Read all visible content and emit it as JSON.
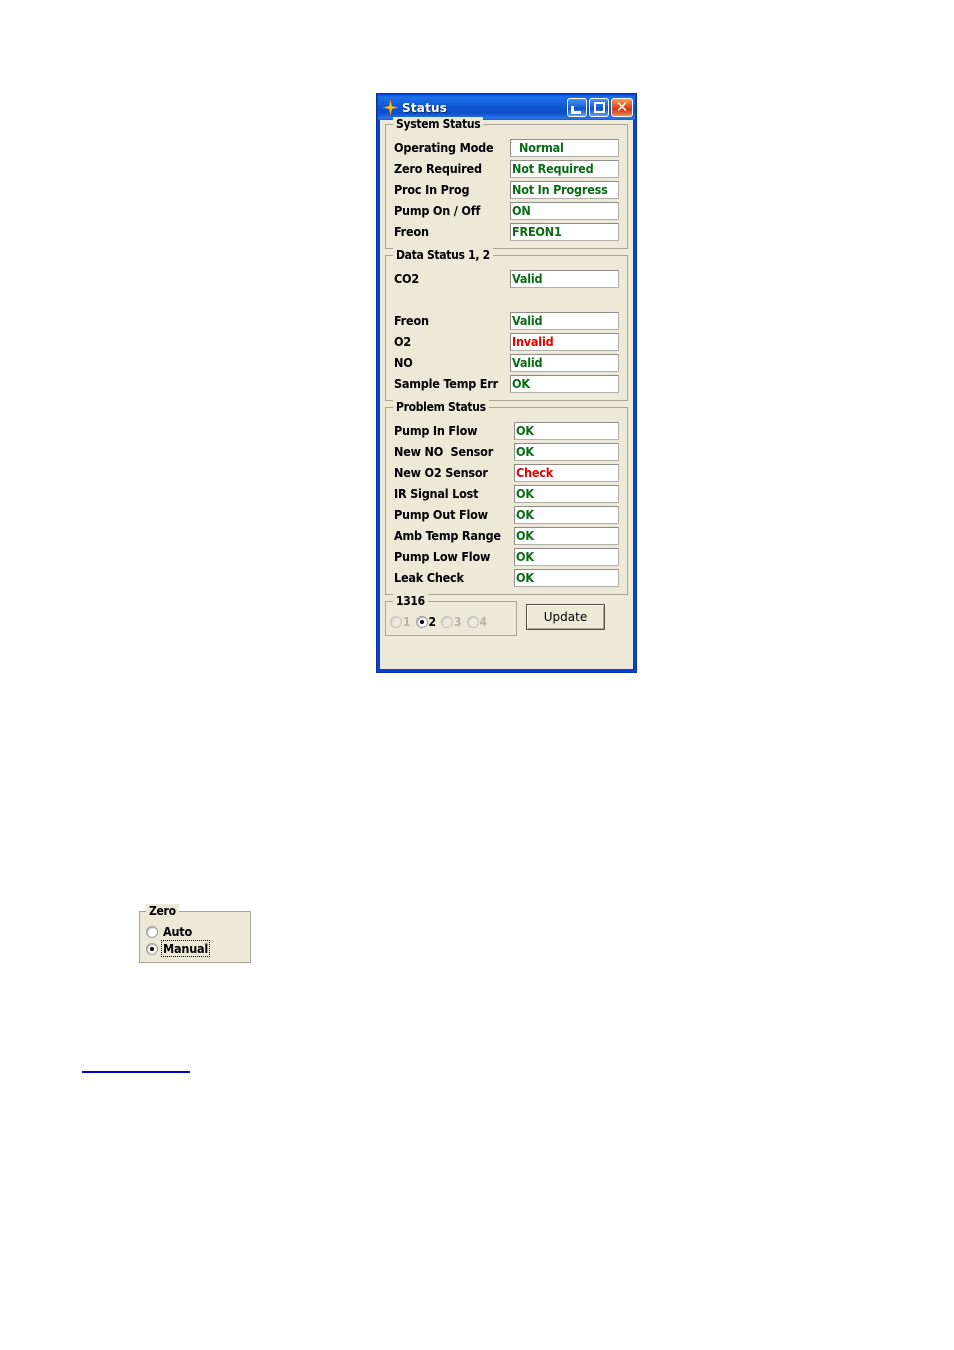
{
  "window": {
    "title": "Status",
    "icon": "sparkle-icon",
    "controls": {
      "minimize": "minimize-icon",
      "maximize": "maximize-icon",
      "close": "✕"
    }
  },
  "colors": {
    "titlebar": "#0f54cf",
    "dialog_bg": "#ece9d8",
    "ok_text": "#0a6b17",
    "alert_text": "#e60000",
    "link": "#0000cc"
  },
  "groups": {
    "system_status": {
      "title": "System Status",
      "rows": [
        {
          "label": "Operating Mode",
          "value": "Normal",
          "state": "ok",
          "indent": true
        },
        {
          "label": "Zero Required",
          "value": "Not Required",
          "state": "ok",
          "indent": false
        },
        {
          "label": "Proc In Prog",
          "value": "Not In Progress",
          "state": "ok",
          "indent": false
        },
        {
          "label": "Pump On / Off",
          "value": "ON",
          "state": "ok",
          "indent": false
        },
        {
          "label": "Freon",
          "value": "FREON1",
          "state": "ok",
          "indent": false
        }
      ]
    },
    "data_status": {
      "title": "Data Status 1, 2",
      "rows": [
        {
          "label": "CO2",
          "value": "Valid",
          "state": "ok"
        },
        {
          "label": "",
          "value": "",
          "state": "spacer"
        },
        {
          "label": "Freon",
          "value": "Valid",
          "state": "ok"
        },
        {
          "label": "O2",
          "value": "Invalid",
          "state": "bad"
        },
        {
          "label": "NO",
          "value": "Valid",
          "state": "ok"
        },
        {
          "label": "Sample Temp Err",
          "value": "OK",
          "state": "ok"
        }
      ]
    },
    "problem_status": {
      "title": "Problem Status",
      "rows": [
        {
          "label": "Pump In Flow",
          "value": "OK",
          "state": "ok"
        },
        {
          "label": "New NO  Sensor",
          "value": "OK",
          "state": "ok"
        },
        {
          "label": "New O2 Sensor",
          "value": "Check",
          "state": "bad"
        },
        {
          "label": "IR Signal Lost",
          "value": "OK",
          "state": "ok"
        },
        {
          "label": "Pump Out Flow",
          "value": "OK",
          "state": "ok"
        },
        {
          "label": "Amb Temp Range",
          "value": "OK",
          "state": "ok"
        },
        {
          "label": "Pump Low Flow",
          "value": "OK",
          "state": "ok"
        },
        {
          "label": "Leak Check",
          "value": "OK",
          "state": "ok"
        }
      ]
    },
    "channel_select": {
      "title": "1316",
      "options": [
        {
          "label": "1",
          "checked": false,
          "disabled": true
        },
        {
          "label": "2",
          "checked": true,
          "disabled": false
        },
        {
          "label": "3",
          "checked": false,
          "disabled": true
        },
        {
          "label": "4",
          "checked": false,
          "disabled": true
        }
      ]
    }
  },
  "update_button": {
    "label": "Update"
  },
  "zero_group": {
    "title": "Zero",
    "options": [
      {
        "label": "Auto",
        "checked": false,
        "focused": false
      },
      {
        "label": "Manual",
        "checked": true,
        "focused": true
      }
    ]
  }
}
